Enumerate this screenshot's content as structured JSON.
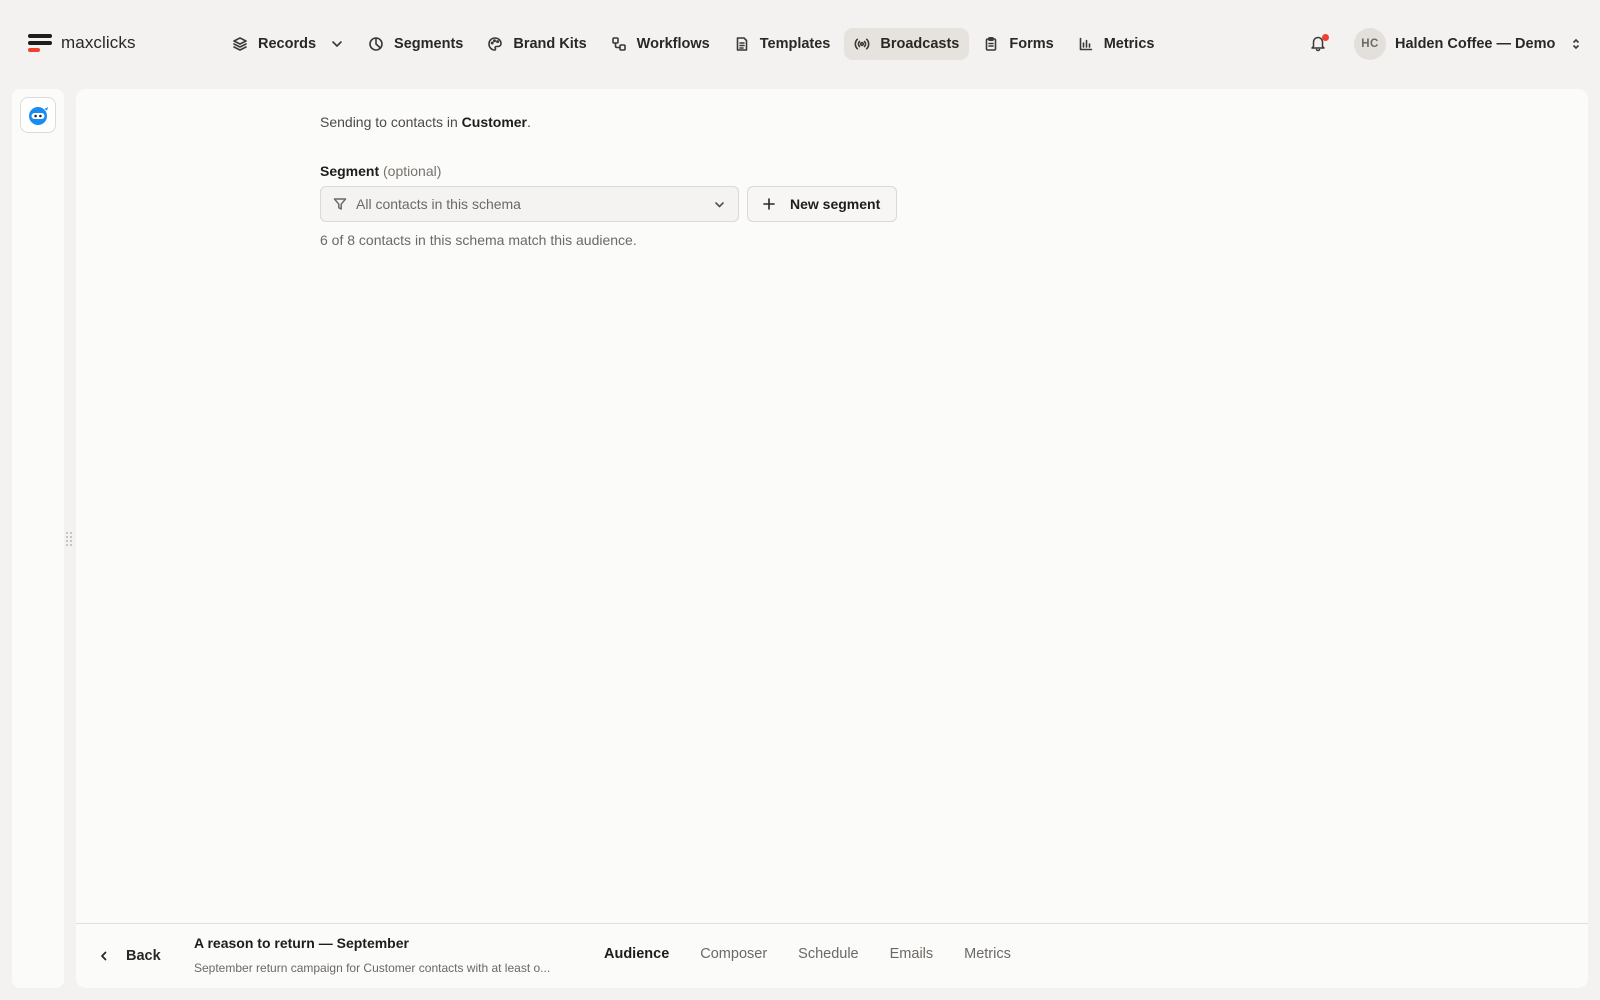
{
  "app": {
    "name": "maxclicks"
  },
  "nav": {
    "items": [
      {
        "id": "records",
        "label": "Records",
        "icon": "layers-icon",
        "has_dropdown": true,
        "active": false
      },
      {
        "id": "segments",
        "label": "Segments",
        "icon": "pie-chart-icon",
        "active": false
      },
      {
        "id": "brand-kits",
        "label": "Brand Kits",
        "icon": "palette-icon",
        "active": false
      },
      {
        "id": "workflows",
        "label": "Workflows",
        "icon": "workflow-icon",
        "active": false
      },
      {
        "id": "templates",
        "label": "Templates",
        "icon": "document-icon",
        "active": false
      },
      {
        "id": "broadcasts",
        "label": "Broadcasts",
        "icon": "broadcast-icon",
        "active": true
      },
      {
        "id": "forms",
        "label": "Forms",
        "icon": "clipboard-icon",
        "active": false
      },
      {
        "id": "metrics",
        "label": "Metrics",
        "icon": "bar-chart-icon",
        "active": false
      }
    ]
  },
  "notifications": {
    "icon": "bell-icon",
    "has_unread": true
  },
  "account": {
    "initials": "HC",
    "name": "Halden Coffee — Demo"
  },
  "audience": {
    "sending_prefix": "Sending to contacts in ",
    "schema_name": "Customer",
    "sending_suffix": ".",
    "segment_label": "Segment",
    "segment_optional": "(optional)",
    "segment_value": "All contacts in this schema",
    "new_segment_label": "New segment",
    "match_text": "6 of 8 contacts in this schema match this audience."
  },
  "footer": {
    "back_label": "Back",
    "campaign_title": "A reason to return — September",
    "campaign_description": "September return campaign for Customer contacts with at least o...",
    "tabs": [
      {
        "label": "Audience",
        "active": true
      },
      {
        "label": "Composer",
        "active": false
      },
      {
        "label": "Schedule",
        "active": false
      },
      {
        "label": "Emails",
        "active": false
      },
      {
        "label": "Metrics",
        "active": false
      }
    ]
  },
  "colors": {
    "accent_red": "#f0412e",
    "active_nav_bg": "#e6e3de",
    "bot_blue": "#1a8cf0"
  }
}
